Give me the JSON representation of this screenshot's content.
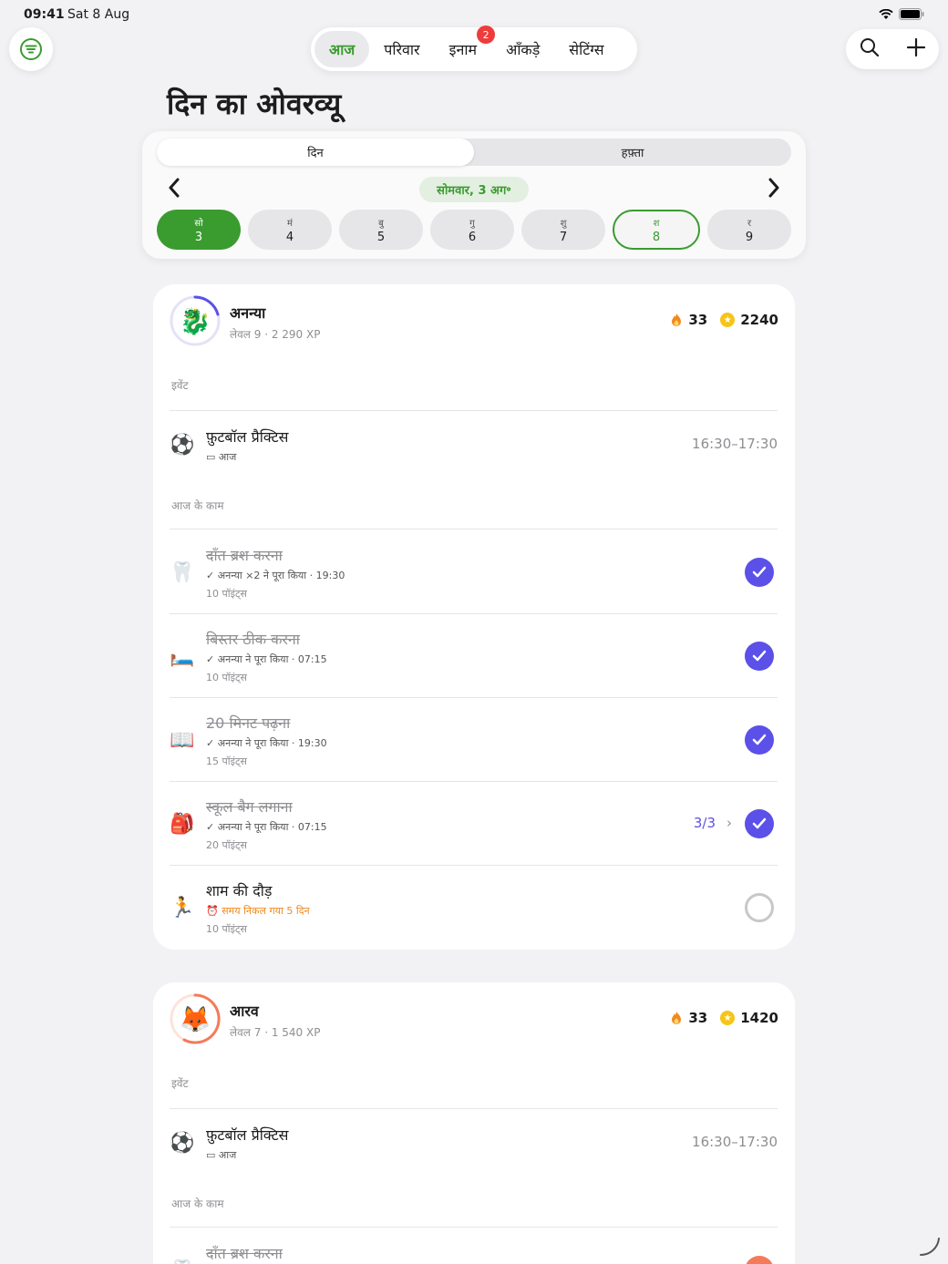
{
  "status_bar": {
    "time": "09:41",
    "date": "Sat 8 Aug"
  },
  "tabs": [
    {
      "label": "आज",
      "active": true
    },
    {
      "label": "परिवार",
      "active": false
    },
    {
      "label": "इनाम",
      "active": false,
      "badge": "2"
    },
    {
      "label": "आँकड़े",
      "active": false
    },
    {
      "label": "सेटिंग्स",
      "active": false
    }
  ],
  "page_title": "दिन का ओवरव्यू",
  "calendar": {
    "segments": [
      "दिन",
      "हफ़्ता"
    ],
    "current_date": "सोमवार, 3 अग॰",
    "days": [
      {
        "letter": "सो",
        "num": "3"
      },
      {
        "letter": "मं",
        "num": "4"
      },
      {
        "letter": "बु",
        "num": "5"
      },
      {
        "letter": "गु",
        "num": "6"
      },
      {
        "letter": "शु",
        "num": "7"
      },
      {
        "letter": "श",
        "num": "8"
      },
      {
        "letter": "र",
        "num": "9"
      }
    ]
  },
  "profiles": [
    {
      "name": "अनन्या",
      "level": "लेवल 9 · 2 290 XP",
      "avatar": "🐉",
      "streak": "33",
      "points": "2240",
      "events_label": "इवेंट",
      "event": {
        "emoji": "⚽",
        "title": "फ़ुटबॉल प्रैक्टिस",
        "meta": "आज",
        "time": "16:30–17:30"
      },
      "tasks_label": "आज के काम",
      "tasks": [
        {
          "emoji": "🦷",
          "title": "दाँत ब्रश करना",
          "meta": "✓ अनन्या ×2 ने पूरा किया · 19:30",
          "points": "10 पॉइंट्स"
        },
        {
          "emoji": "🛏️",
          "title": "बिस्तर ठीक करना",
          "meta": "✓ अनन्या ने पूरा किया · 07:15",
          "points": "10 पॉइंट्स"
        },
        {
          "emoji": "📖",
          "title": "20 मिनट पढ़ना",
          "meta": "✓ अनन्या ने पूरा किया · 19:30",
          "points": "15 पॉइंट्स"
        },
        {
          "emoji": "🎒",
          "title": "स्कूल बैग लगाना",
          "meta": "✓ अनन्या ने पूरा किया · 07:15",
          "points": "20 पॉइंट्स",
          "counter": "3/3"
        },
        {
          "emoji": "🏃",
          "title": "शाम की दौड़",
          "meta": "⏰ समय निकल गया  5 दिन",
          "points": "10 पॉइंट्स"
        }
      ]
    },
    {
      "name": "आरव",
      "level": "लेवल 7 · 1 540 XP",
      "avatar": "🦊",
      "streak": "33",
      "points": "1420",
      "events_label": "इवेंट",
      "event": {
        "emoji": "⚽",
        "title": "फ़ुटबॉल प्रैक्टिस",
        "meta": "आज",
        "time": "16:30–17:30"
      },
      "tasks_label": "आज के काम",
      "tasks": [
        {
          "emoji": "🦷",
          "title": "दाँत ब्रश करना"
        }
      ]
    }
  ],
  "colors": {
    "accent_green": "#3a9b2f",
    "check_purple": "#5b50e8",
    "badge_red": "#ef3b3b",
    "overdue_orange": "#f08a1d"
  }
}
